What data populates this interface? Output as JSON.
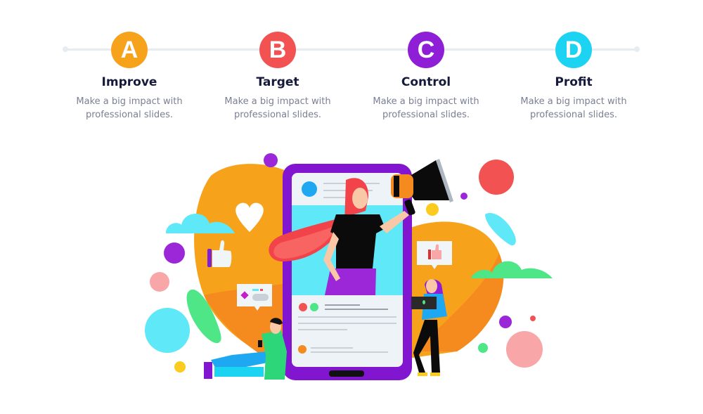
{
  "steps": [
    {
      "letter": "A",
      "title": "Improve",
      "desc1": "Make a big impact with",
      "desc2": "professional slides.",
      "color": "#f7a21b"
    },
    {
      "letter": "B",
      "title": "Target",
      "desc1": "Make a big impact with",
      "desc2": "professional slides.",
      "color": "#f25252"
    },
    {
      "letter": "C",
      "title": "Control",
      "desc1": "Make a big impact with",
      "desc2": "professional slides.",
      "color": "#8f1fd6"
    },
    {
      "letter": "D",
      "title": "Profit",
      "desc1": "Make a big impact with",
      "desc2": "professional slides.",
      "color": "#1cd3f2"
    }
  ],
  "illustration": {
    "description": "Social media marketing: phone with woman holding megaphone, people with devices, like and heart icons"
  }
}
